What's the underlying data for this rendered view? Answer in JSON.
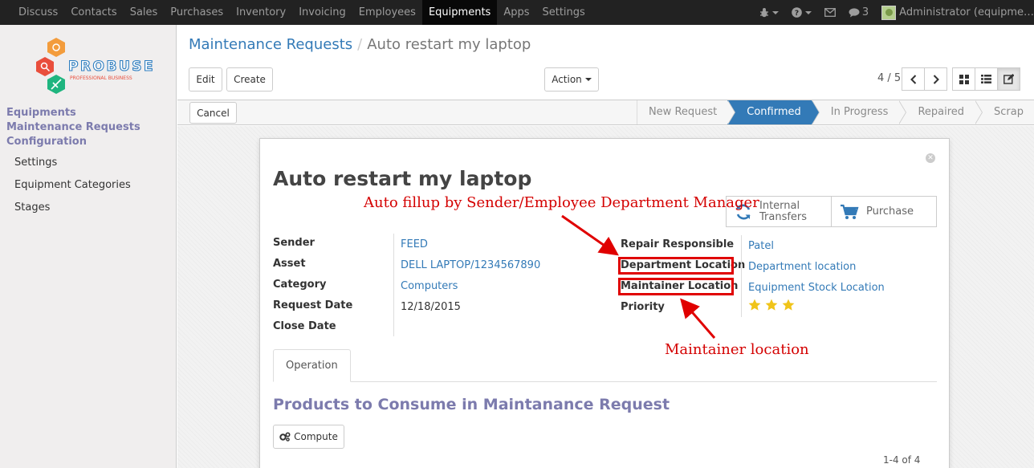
{
  "topnav": {
    "menu": [
      "Discuss",
      "Contacts",
      "Sales",
      "Purchases",
      "Inventory",
      "Invoicing",
      "Employees",
      "Equipments",
      "Apps",
      "Settings"
    ],
    "active_menu": "Equipments",
    "messages_count": "3",
    "user": "Administrator (equipme…"
  },
  "sidebar": {
    "logo_text": "PROBUSE",
    "logo_subtext": "PROFESSIONAL BUSINESS",
    "sections": [
      "Equipments",
      "Maintenance Requests",
      "Configuration"
    ],
    "config_items": [
      "Settings",
      "Equipment Categories",
      "Stages"
    ]
  },
  "breadcrumb": {
    "parent": "Maintenance Requests",
    "current": "Auto restart my laptop"
  },
  "buttons": {
    "edit": "Edit",
    "create": "Create",
    "action": "Action",
    "cancel": "Cancel",
    "compute": "Compute"
  },
  "pager": {
    "text": "4 / 5"
  },
  "stages": [
    "New Request",
    "Confirmed",
    "In Progress",
    "Repaired",
    "Scrap"
  ],
  "active_stage": "Confirmed",
  "record": {
    "title": "Auto restart my laptop",
    "smart_buttons": {
      "internal_transfers": [
        "Internal",
        "Transfers"
      ],
      "purchase": "Purchase"
    },
    "left_fields": [
      {
        "label": "Sender",
        "value": "FEED",
        "link": true
      },
      {
        "label": "Asset",
        "value": "DELL LAPTOP/1234567890",
        "link": true
      },
      {
        "label": "Category",
        "value": "Computers",
        "link": true
      },
      {
        "label": "Request Date",
        "value": "12/18/2015",
        "link": false
      },
      {
        "label": "Close Date",
        "value": "",
        "link": false
      }
    ],
    "right_fields": [
      {
        "label": "Repair Responsible",
        "value": "Patel",
        "link": true
      },
      {
        "label": "Department Location",
        "value": "Department location",
        "link": true
      },
      {
        "label": "Maintainer Location",
        "value": "Equipment Stock Location",
        "link": true
      },
      {
        "label": "Priority",
        "value": "",
        "link": false
      }
    ],
    "priority_stars": 3,
    "tab": "Operation",
    "section_title": "Products to Consume in Maintanance Request",
    "lines_pager": "1-4 of 4"
  },
  "annotations": {
    "top": "Auto fillup by Sender/Employee Department Manager",
    "bottom": "Maintainer location"
  },
  "colors": {
    "navbar": "#222222",
    "link": "#337ab7",
    "active_stage": "#337ab7",
    "sidebar_heading": "#7c7bad",
    "annotation_red": "#d40000",
    "star": "#f0c419"
  }
}
